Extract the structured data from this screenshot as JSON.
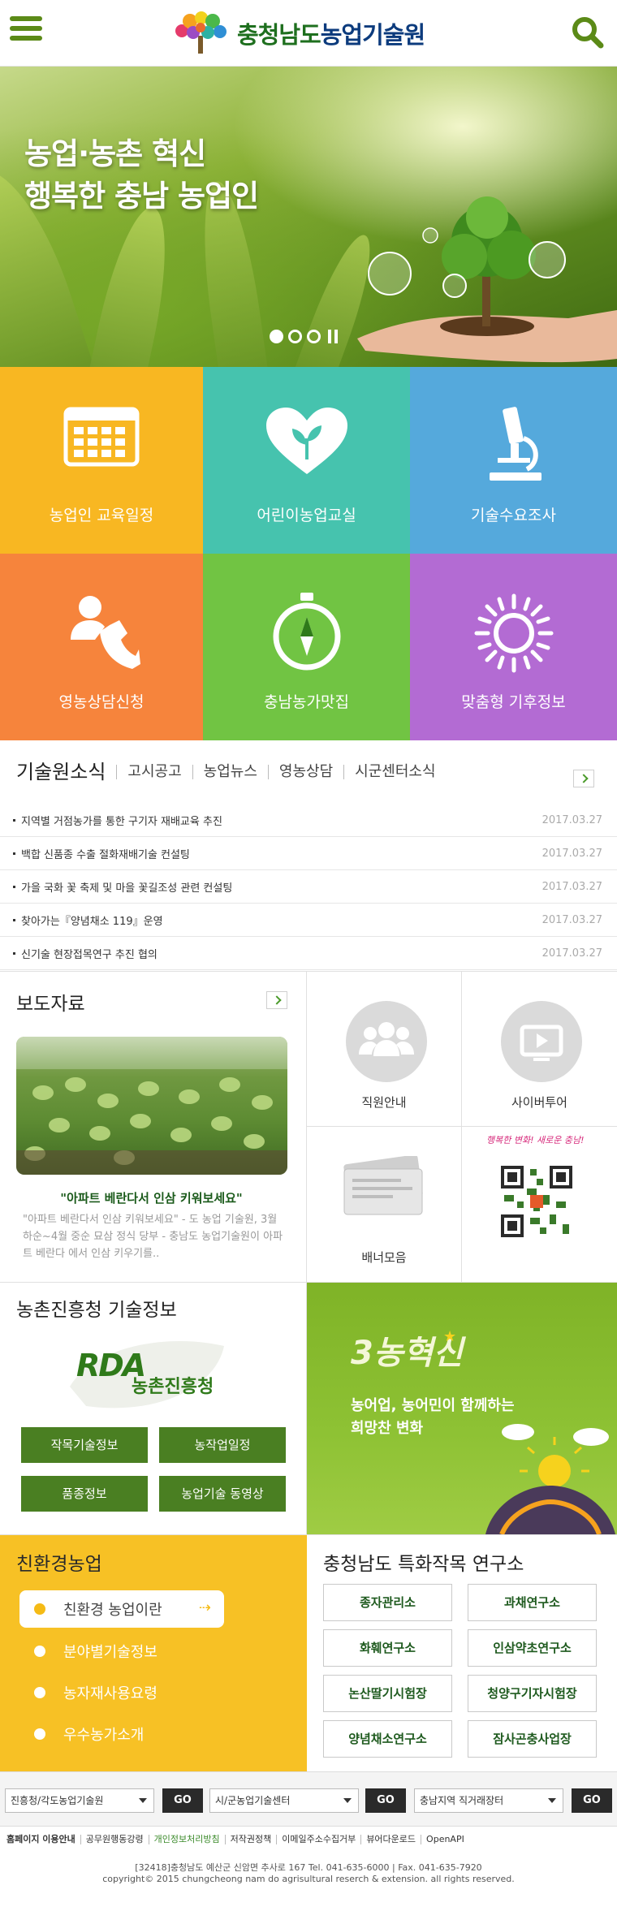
{
  "header": {
    "logo_prefix": "충청남도",
    "logo_suffix": "농업기술원"
  },
  "hero": {
    "line1": "농업·농촌 혁신",
    "line2": "행복한 충남 농업인",
    "slide_count": 3,
    "active_slide": 1
  },
  "tiles": [
    {
      "label": "농업인 교육일정",
      "icon": "calendar-icon",
      "color": "#f8b722"
    },
    {
      "label": "어린이농업교실",
      "icon": "heart-sprout-icon",
      "color": "#46c3ae"
    },
    {
      "label": "기술수요조사",
      "icon": "microscope-icon",
      "color": "#55a9dc"
    },
    {
      "label": "영농상담신청",
      "icon": "phone-person-icon",
      "color": "#f6843c"
    },
    {
      "label": "충남농가맛집",
      "icon": "compass-icon",
      "color": "#71c443"
    },
    {
      "label": "맞춤형 기후정보",
      "icon": "sun-icon",
      "color": "#b36bd3"
    }
  ],
  "news": {
    "tabs": [
      "기술원소식",
      "고시공고",
      "농업뉴스",
      "영농상담",
      "시군센터소식"
    ],
    "items": [
      {
        "title": "지역별 거점농가를 통한 구기자 재배교육 추진",
        "date": "2017.03.27"
      },
      {
        "title": "백합 신품종 수출 절화재배기술 컨설팅",
        "date": "2017.03.27"
      },
      {
        "title": "가을 국화 꽃 축제 및 마을 꽃길조성 관련 컨설팅",
        "date": "2017.03.27"
      },
      {
        "title": "찾아가는『양념채소 119』운영",
        "date": "2017.03.27"
      },
      {
        "title": "신기술 현장접목연구 추진 협의",
        "date": "2017.03.27"
      }
    ]
  },
  "press": {
    "title": "보도자료",
    "caption": "\"아파트 베란다서 인삼 키워보세요\"",
    "desc": "\"아파트 베란다서 인삼 키워보세요\" - 도 농업 기술원, 3월 하순~4월 중순 묘삼 정식 당부 - 충남도 농업기술원이 아파트 베란다 에서 인삼 키우기를.."
  },
  "quick_links": [
    {
      "label": "직원안내",
      "icon": "group-icon"
    },
    {
      "label": "사이버투어",
      "icon": "play-screen-icon"
    },
    {
      "label": "배너모음",
      "icon": "banner-cards-icon"
    },
    {
      "label": "행복한 변화! 새로운 충남!",
      "icon": "qr-code-icon"
    }
  ],
  "rda": {
    "title": "농촌진흥청 기술정보",
    "logo_text": "RDA",
    "logo_sub": "농촌진흥청",
    "buttons": [
      "작목기술정보",
      "농작업일정",
      "품종정보",
      "농업기술 동영상"
    ]
  },
  "nong": {
    "title": "3농혁신",
    "line1": "농어업, 농어민이 함께하는",
    "line2": "희망찬 변화"
  },
  "eco": {
    "title": "친환경농업",
    "items": [
      "친환경 농업이란",
      "분야별기술정보",
      "농자재사용요령",
      "우수농가소개"
    ]
  },
  "institutes": {
    "title": "충청남도 특화작목 연구소",
    "items": [
      "종자관리소",
      "과채연구소",
      "화훼연구소",
      "인삼약초연구소",
      "논산딸기시험장",
      "청양구기자시험장",
      "양념채소연구소",
      "잠사곤충사업장"
    ]
  },
  "selects": [
    {
      "value": "진흥청/각도농업기술원",
      "go": "GO"
    },
    {
      "value": "시/군농업기술센터",
      "go": "GO"
    },
    {
      "value": "충남지역 직거래장터",
      "go": "GO"
    }
  ],
  "footer": {
    "links": [
      "홈페이지 이용안내",
      "공무원행동강령",
      "개인정보처리방침",
      "저작권정책",
      "이메일주소수집거부",
      "뷰어다운로드",
      "OpenAPI"
    ],
    "address": "[32418]충청남도 예산군 신암면 추사로 167 Tel. 041-635-6000 | Fax. 041-635-7920",
    "copyright": "copyright© 2015 chungcheong nam do agrisultural reserch & extension. all rights reserved."
  },
  "colors": {
    "brand_green": "#4a7f22",
    "eco_yellow": "#f7c125",
    "logo_navy": "#0c3b7d"
  }
}
